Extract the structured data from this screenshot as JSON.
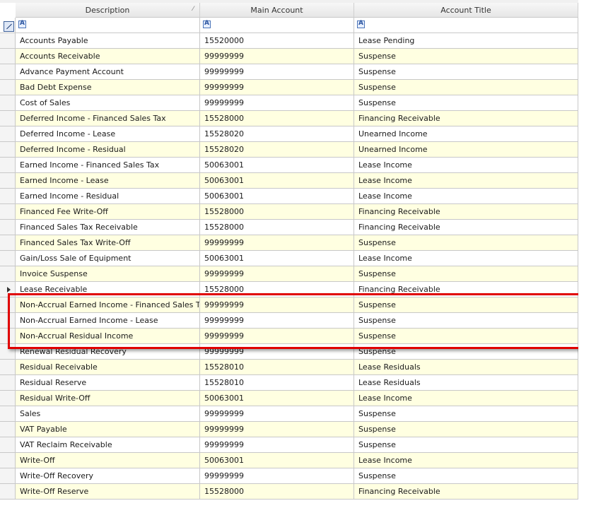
{
  "columns": {
    "description": "Description",
    "main_account": "Main Account",
    "account_title": "Account Title"
  },
  "rows": [
    {
      "description": "Accounts Payable",
      "main_account": "15520000",
      "account_title": "Lease Pending"
    },
    {
      "description": "Accounts Receivable",
      "main_account": "99999999",
      "account_title": "Suspense"
    },
    {
      "description": "Advance Payment Account",
      "main_account": "99999999",
      "account_title": "Suspense"
    },
    {
      "description": "Bad Debt Expense",
      "main_account": "99999999",
      "account_title": "Suspense"
    },
    {
      "description": "Cost of Sales",
      "main_account": "99999999",
      "account_title": "Suspense"
    },
    {
      "description": "Deferred Income - Financed Sales Tax",
      "main_account": "15528000",
      "account_title": "Financing Receivable"
    },
    {
      "description": "Deferred Income - Lease",
      "main_account": "15528020",
      "account_title": "Unearned Income"
    },
    {
      "description": "Deferred Income - Residual",
      "main_account": "15528020",
      "account_title": "Unearned Income"
    },
    {
      "description": "Earned Income - Financed Sales Tax",
      "main_account": "50063001",
      "account_title": "Lease Income"
    },
    {
      "description": "Earned Income - Lease",
      "main_account": "50063001",
      "account_title": "Lease Income"
    },
    {
      "description": "Earned Income - Residual",
      "main_account": "50063001",
      "account_title": "Lease Income"
    },
    {
      "description": "Financed Fee Write-Off",
      "main_account": "15528000",
      "account_title": "Financing Receivable"
    },
    {
      "description": "Financed Sales Tax Receivable",
      "main_account": "15528000",
      "account_title": "Financing Receivable"
    },
    {
      "description": "Financed Sales Tax Write-Off",
      "main_account": "99999999",
      "account_title": "Suspense"
    },
    {
      "description": "Gain/Loss Sale of Equipment",
      "main_account": "50063001",
      "account_title": "Lease Income"
    },
    {
      "description": "Invoice Suspense",
      "main_account": "99999999",
      "account_title": "Suspense"
    },
    {
      "description": "Lease Receivable",
      "main_account": "15528000",
      "account_title": "Financing Receivable"
    },
    {
      "description": "Non-Accrual Earned Income - Financed Sales Tax",
      "main_account": "99999999",
      "account_title": "Suspense"
    },
    {
      "description": "Non-Accrual Earned Income - Lease",
      "main_account": "99999999",
      "account_title": "Suspense"
    },
    {
      "description": "Non-Accrual Residual Income",
      "main_account": "99999999",
      "account_title": "Suspense"
    },
    {
      "description": "Renewal Residual Recovery",
      "main_account": "99999999",
      "account_title": "Suspense"
    },
    {
      "description": "Residual Receivable",
      "main_account": "15528010",
      "account_title": "Lease Residuals"
    },
    {
      "description": "Residual Reserve",
      "main_account": "15528010",
      "account_title": "Lease Residuals"
    },
    {
      "description": "Residual Write-Off",
      "main_account": "50063001",
      "account_title": "Lease Income"
    },
    {
      "description": "Sales",
      "main_account": "99999999",
      "account_title": "Suspense"
    },
    {
      "description": "VAT Payable",
      "main_account": "99999999",
      "account_title": "Suspense"
    },
    {
      "description": "VAT Reclaim Receivable",
      "main_account": "99999999",
      "account_title": "Suspense"
    },
    {
      "description": "Write-Off",
      "main_account": "50063001",
      "account_title": "Lease Income"
    },
    {
      "description": "Write-Off Recovery",
      "main_account": "99999999",
      "account_title": "Suspense"
    },
    {
      "description": "Write-Off Reserve",
      "main_account": "15528000",
      "account_title": "Financing Receivable"
    }
  ],
  "alternating_row_color": "#ffffe1",
  "highlight_color": "#e00000"
}
